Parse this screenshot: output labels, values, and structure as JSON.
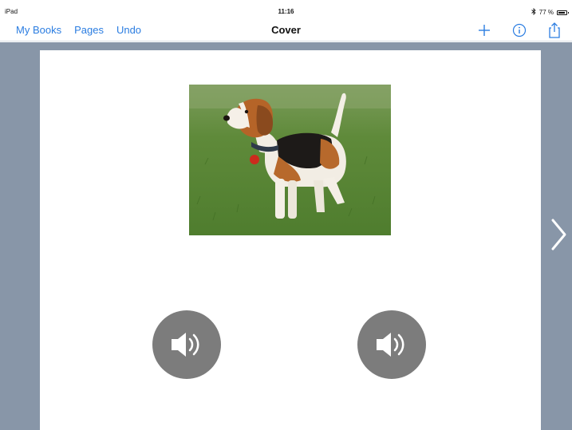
{
  "status": {
    "device": "iPad",
    "time": "11:16",
    "battery": "77 %",
    "battery_level": 0.77,
    "bluetooth_icon": "bluetooth-icon"
  },
  "nav": {
    "links": [
      "My Books",
      "Pages",
      "Undo"
    ],
    "title": "Cover",
    "icons": [
      "plus-icon",
      "info-icon",
      "share-icon"
    ]
  },
  "page": {
    "image": "beagle-dog-photo",
    "sound_buttons": [
      "speaker-icon",
      "speaker-icon"
    ]
  },
  "navigation": {
    "next_icon": "chevron-right-icon"
  },
  "colors": {
    "accent": "#2b7de1",
    "canvas_bg": "#8896a8",
    "sound_button": "#7c7c7c"
  }
}
